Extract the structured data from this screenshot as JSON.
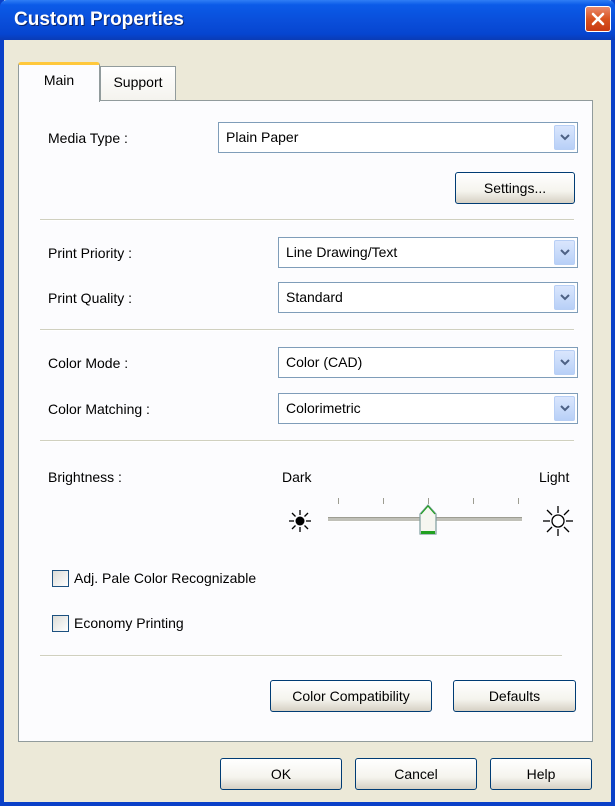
{
  "window": {
    "title": "Custom Properties"
  },
  "tabs": [
    {
      "label": "Main"
    },
    {
      "label": "Support"
    }
  ],
  "media": {
    "label": "Media Type :",
    "value": "Plain Paper",
    "settings_button": "Settings..."
  },
  "print_priority": {
    "label": "Print Priority :",
    "value": "Line Drawing/Text"
  },
  "print_quality": {
    "label": "Print Quality :",
    "value": "Standard"
  },
  "color_mode": {
    "label": "Color Mode :",
    "value": "Color (CAD)"
  },
  "color_matching": {
    "label": "Color Matching :",
    "value": "Colorimetric"
  },
  "brightness": {
    "label": "Brightness :",
    "min_label": "Dark",
    "max_label": "Light",
    "tick_count": 5,
    "value_fraction": 0.5
  },
  "checkboxes": [
    {
      "label": "Adj. Pale Color Recognizable",
      "checked": false
    },
    {
      "label": "Economy Printing",
      "checked": false
    }
  ],
  "panel_buttons": {
    "color_compat": "Color Compatibility",
    "defaults": "Defaults"
  },
  "footer_buttons": {
    "ok": "OK",
    "cancel": "Cancel",
    "help": "Help"
  },
  "colors": {
    "titlebar": "#0a4fdb",
    "tab_highlight": "#ffc83c",
    "close": "#d9531f",
    "thumb": "#21a121"
  }
}
